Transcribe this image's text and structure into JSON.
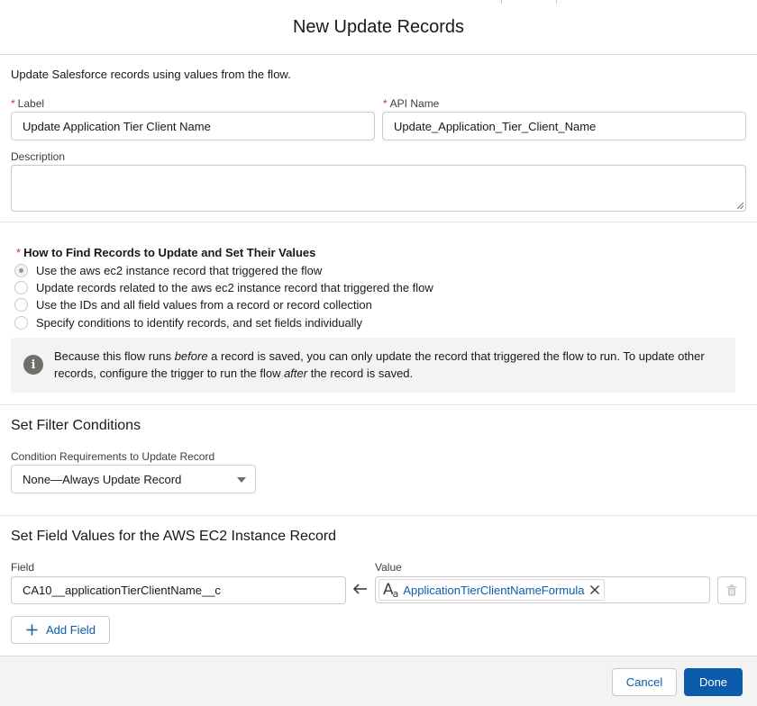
{
  "modal": {
    "title": "New Update Records",
    "description": "Update Salesforce records using values from the flow."
  },
  "fields": {
    "label": {
      "label": "Label",
      "required": "*",
      "value": "Update Application Tier Client Name"
    },
    "api_name": {
      "label": "API Name",
      "required": "*",
      "value": "Update_Application_Tier_Client_Name"
    },
    "description": {
      "label": "Description",
      "value": ""
    }
  },
  "find_records": {
    "required": "*",
    "heading": "How to Find Records to Update and Set Their Values",
    "options": [
      {
        "label": "Use the aws ec2 instance record that triggered the flow",
        "selected": true
      },
      {
        "label": "Update records related to the aws ec2 instance record that triggered the flow",
        "selected": false
      },
      {
        "label": "Use the IDs and all field values from a record or record collection",
        "selected": false
      },
      {
        "label": "Specify conditions to identify records, and set fields individually",
        "selected": false
      }
    ],
    "info": {
      "icon": "info-icon",
      "part1": "Because this flow runs ",
      "em1": "before",
      "part2": " a record is saved, you can only update the record that triggered the flow to run. To update other records, configure the trigger to run the flow ",
      "em2": "after",
      "part3": " the record is saved."
    }
  },
  "filter": {
    "title": "Set Filter Conditions",
    "requirement_label": "Condition Requirements to Update Record",
    "requirement_value": "None—Always Update Record"
  },
  "field_values": {
    "title": "Set Field Values for the AWS EC2 Instance Record",
    "field_label": "Field",
    "value_label": "Value",
    "rows": [
      {
        "field": "CA10__applicationTierClientName__c",
        "value": "ApplicationTierClientNameFormula"
      }
    ],
    "add_field_label": "Add Field"
  },
  "footer": {
    "cancel_label": "Cancel",
    "done_label": "Done"
  },
  "colors": {
    "brand": "#0b5cab",
    "required": "#c23934",
    "border": "#c9c9c9",
    "info_bg": "#f3f3f3"
  }
}
